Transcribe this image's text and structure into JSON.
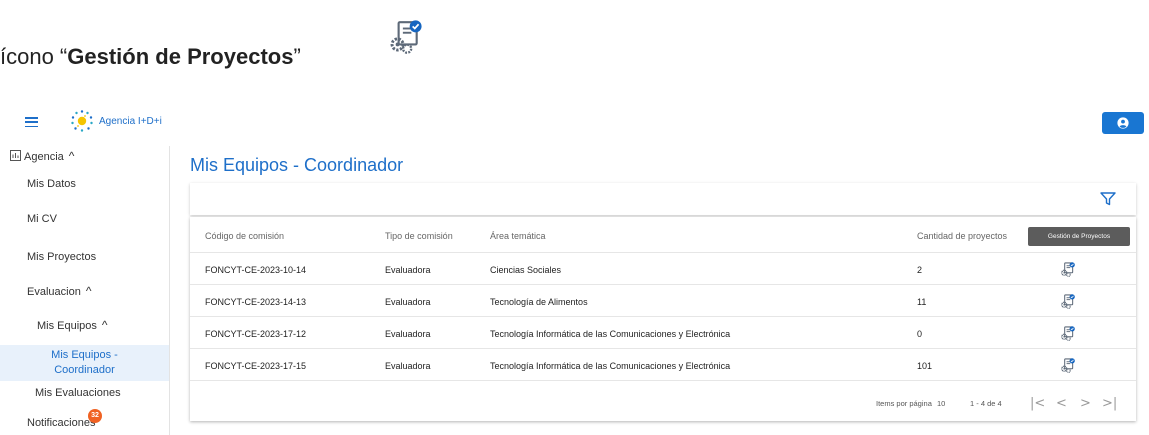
{
  "caption": {
    "prefix": "ícono “",
    "bold": "Gestión de Proyectos",
    "suffix": "”"
  },
  "header": {
    "logo_text": "Agencia I+D+i",
    "user_icon": "user-circle-icon",
    "user_button_color": "#1976d2"
  },
  "sidebar": {
    "agencia": "Agencia",
    "mis_datos": "Mis Datos",
    "mi_cv": "Mi CV",
    "mis_proyectos": "Mis Proyectos",
    "evaluacion": "Evaluacion",
    "mis_equipos": "Mis Equipos",
    "mis_equipos_coordinador": "Mis Equipos - Coordinador",
    "mis_evaluaciones": "Mis Evaluaciones",
    "notificaciones": "Notificaciones",
    "notificaciones_badge": "32"
  },
  "main": {
    "title": "Mis Equipos - Coordinador",
    "table": {
      "headers": [
        "Código de comisión",
        "Tipo de comisión",
        "Área temática",
        "Cantidad de proyectos"
      ],
      "tooltip": "Gestión de Proyectos",
      "rows": [
        [
          "FONCYT-CE-2023-10-14",
          "Evaluadora",
          "Ciencias Sociales",
          "2"
        ],
        [
          "FONCYT-CE-2023-14-13",
          "Evaluadora",
          "Tecnología de Alimentos",
          "11"
        ],
        [
          "FONCYT-CE-2023-17-12",
          "Evaluadora",
          "Tecnología Informática de las Comunicaciones y Electrónica",
          "0"
        ],
        [
          "FONCYT-CE-2023-17-15",
          "Evaluadora",
          "Tecnología Informática de las Comunicaciones y Electrónica",
          "101"
        ]
      ]
    },
    "paginator": {
      "items_per_page_label": "Items por página",
      "items_per_page": "10",
      "range": "1 - 4 de 4",
      "first": "|<",
      "prev": "<",
      "next": ">",
      "last": ">|"
    }
  },
  "colors": {
    "accent": "#1e6fc9",
    "badge": "#f06223",
    "active_bg": "#e8f1fb"
  }
}
